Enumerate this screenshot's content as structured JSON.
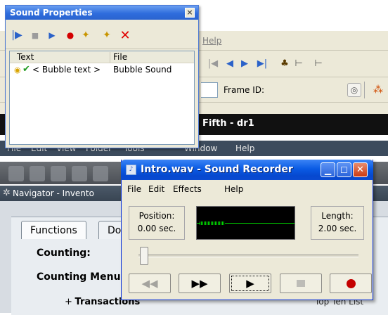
{
  "background_app": {
    "menu_help": "Help",
    "frame_label": "Frame ID:",
    "document_title": "Fifth - dr1",
    "inner_menu": [
      "File",
      "Edit",
      "View",
      "Folder",
      "Tools",
      "Window",
      "Help"
    ],
    "navigator_label": "Navigator - Invento",
    "tabs": [
      "Functions",
      "Do"
    ],
    "counting_label": "Counting:",
    "counting_menu_label": "Counting Menu",
    "tree_item": "Transactions",
    "tree_expander": "+",
    "top_ten_list": "Top Ten List"
  },
  "sound_properties": {
    "title": "Sound Properties",
    "close_glyph": "×",
    "columns": {
      "text": "Text",
      "file": "File"
    },
    "rows": [
      {
        "text": "< Bubble text >",
        "file": "Bubble Sound"
      }
    ]
  },
  "sound_recorder": {
    "title": "Intro.wav - Sound Recorder",
    "menu": [
      "File",
      "Edit",
      "Effects",
      "Help"
    ],
    "position_label": "Position:",
    "position_value": "0.00 sec.",
    "length_label": "Length:",
    "length_value": "2.00 sec.",
    "slider_position": 0.0
  },
  "icons": {
    "ffw": "▶▶",
    "rew": "◀◀",
    "play": "▶"
  },
  "colors": {
    "xp_title_blue": "#0a5be4",
    "wave_green": "#00d000",
    "record_red": "#c40000"
  }
}
